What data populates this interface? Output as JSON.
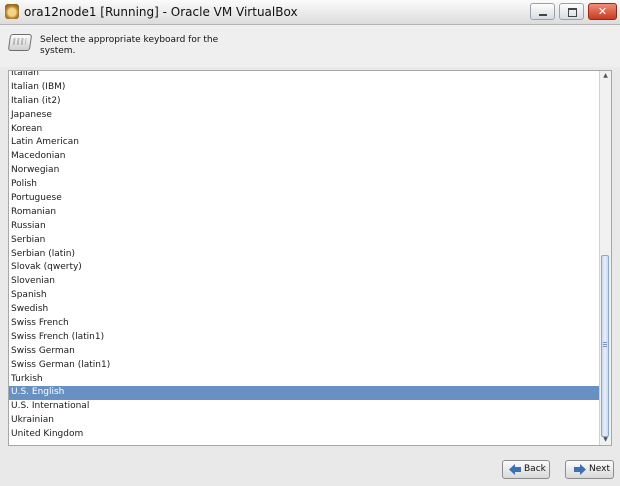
{
  "window": {
    "title": "ora12node1 [Running] - Oracle VM VirtualBox",
    "controls": [
      "minimize",
      "maximize",
      "close"
    ]
  },
  "header": {
    "icon": "keyboard-icon",
    "instruction": "Select the appropriate keyboard for the system."
  },
  "keyboard_list": {
    "items": [
      "Italian",
      "Italian (IBM)",
      "Italian (it2)",
      "Japanese",
      "Korean",
      "Latin American",
      "Macedonian",
      "Norwegian",
      "Polish",
      "Portuguese",
      "Romanian",
      "Russian",
      "Serbian",
      "Serbian (latin)",
      "Slovak (qwerty)",
      "Slovenian",
      "Spanish",
      "Swedish",
      "Swiss French",
      "Swiss French (latin1)",
      "Swiss German",
      "Swiss German (latin1)",
      "Turkish",
      "U.S. English",
      "U.S. International",
      "Ukrainian",
      "United Kingdom"
    ],
    "selected": "U.S. English",
    "selection_color": "#6990c2"
  },
  "buttons": {
    "back_label": "Back",
    "next_label": "Next"
  },
  "colors": {
    "close_button": "#c63b21",
    "arrow_blue": "#3d70b2"
  }
}
